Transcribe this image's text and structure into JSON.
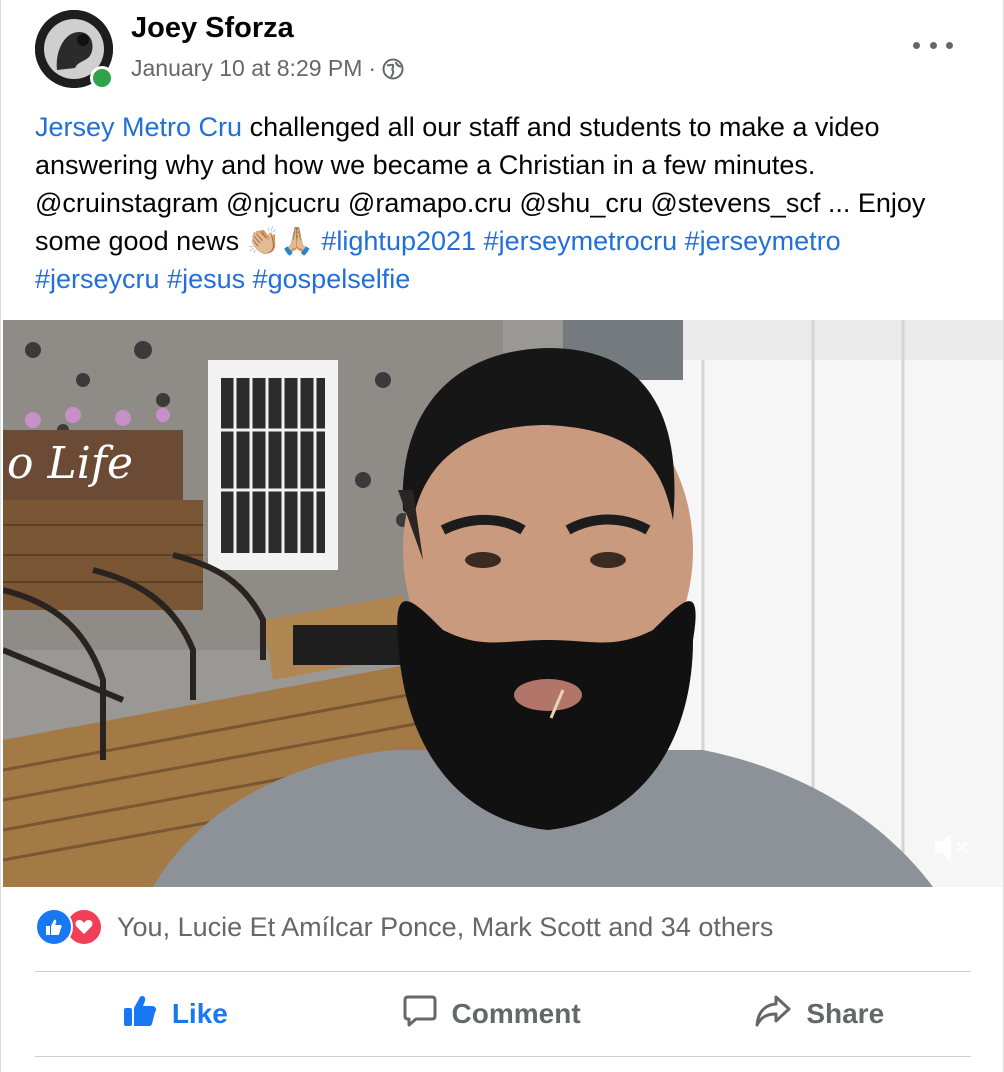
{
  "post": {
    "author": "Joey Sforza",
    "timestamp": "January 10 at 8:29 PM",
    "separator": "·",
    "privacy_icon": "globe-icon",
    "online": true,
    "more_icon": "more-options-icon",
    "text": {
      "link_page": "Jersey Metro Cru",
      "body": " challenged all our staff and students to make a video answering why and how we became a Christian in a few minutes. @cruinstagram @njcucru @ramapo.cru @shu_cru @stevens_scf ... Enjoy some good news ",
      "emoji": "👏🏼🙏🏼",
      "hashtags": [
        "#lightup2021",
        "#jerseymetrocru",
        "#jerseymetro",
        "#jerseycru",
        "#jesus",
        "#gospelselfie"
      ]
    },
    "video": {
      "sign_text": "o Life",
      "muted_icon": "volume-muted-icon"
    }
  },
  "reactions": {
    "icons": [
      "like-reaction-icon",
      "love-reaction-icon"
    ],
    "summary": "You, Lucie Et Amílcar Ponce, Mark Scott and 34 others"
  },
  "actions": {
    "like": "Like",
    "comment": "Comment",
    "share": "Share"
  },
  "colors": {
    "link": "#216fdb",
    "like_active": "#1877f2",
    "love": "#f33e58",
    "secondary_text": "#65676b",
    "online": "#31a24c"
  }
}
